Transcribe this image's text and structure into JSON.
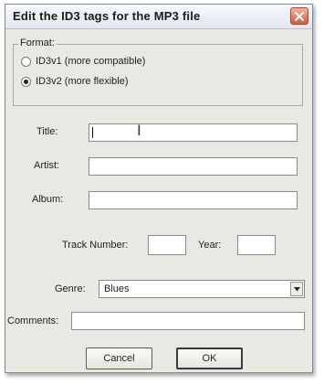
{
  "window": {
    "title": "Edit the ID3 tags for the MP3 file",
    "close_icon": "close-icon"
  },
  "format": {
    "legend": "Format:",
    "options": [
      {
        "label": "ID3v1 (more compatible)",
        "selected": false
      },
      {
        "label": "ID3v2 (more flexible)",
        "selected": true
      }
    ]
  },
  "fields": {
    "title": {
      "label": "Title:",
      "value": ""
    },
    "artist": {
      "label": "Artist:",
      "value": ""
    },
    "album": {
      "label": "Album:",
      "value": ""
    },
    "track_number": {
      "label": "Track Number:",
      "value": ""
    },
    "year": {
      "label": "Year:",
      "value": ""
    },
    "genre": {
      "label": "Genre:",
      "value": "Blues"
    },
    "comments": {
      "label": "Comments:",
      "value": ""
    }
  },
  "buttons": {
    "cancel": "Cancel",
    "ok": "OK"
  },
  "colors": {
    "close_button": "#d35b3f",
    "dialog_background": "#e9e8e2"
  }
}
